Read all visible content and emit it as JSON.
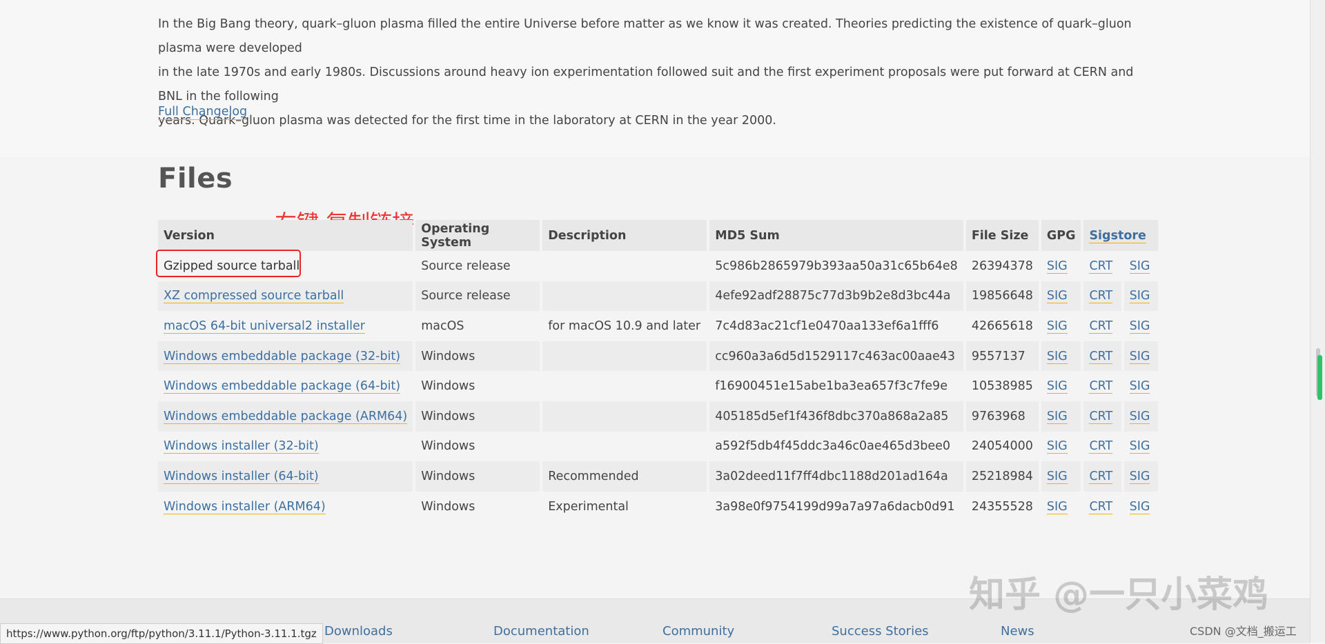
{
  "intro": {
    "line1": "In the Big Bang theory, quark–gluon plasma filled the entire Universe before matter as we know it was created. Theories predicting the existence of quark–gluon plasma were developed",
    "line2": "in the late 1970s and early 1980s. Discussions around heavy ion experimentation followed suit and the first experiment proposals were put forward at CERN and BNL in the following",
    "line3": "years. Quark–gluon plasma was detected for the first time in the laboratory at CERN in the year 2000."
  },
  "changelog_label": "Full Changelog",
  "files": {
    "title": "Files",
    "annotation": "右键 复制链接",
    "headers": {
      "version": "Version",
      "os": "Operating System",
      "description": "Description",
      "md5": "MD5 Sum",
      "size": "File Size",
      "gpg": "GPG",
      "sigstore": "Sigstore"
    },
    "sig_label": "SIG",
    "crt_label": "CRT",
    "rows": [
      {
        "version": "Gzipped source tarball",
        "os": "Source release",
        "description": "",
        "md5": "5c986b2865979b393aa50a31c65b64e8",
        "size": "26394378"
      },
      {
        "version": "XZ compressed source tarball",
        "os": "Source release",
        "description": "",
        "md5": "4efe92adf28875c77d3b9b2e8d3bc44a",
        "size": "19856648"
      },
      {
        "version": "macOS 64-bit universal2 installer",
        "os": "macOS",
        "description": "for macOS 10.9 and later",
        "md5": "7c4d83ac21cf1e0470aa133ef6a1fff6",
        "size": "42665618"
      },
      {
        "version": "Windows embeddable package (32-bit)",
        "os": "Windows",
        "description": "",
        "md5": "cc960a3a6d5d1529117c463ac00aae43",
        "size": "9557137"
      },
      {
        "version": "Windows embeddable package (64-bit)",
        "os": "Windows",
        "description": "",
        "md5": "f16900451e15abe1ba3ea657f3c7fe9e",
        "size": "10538985"
      },
      {
        "version": "Windows embeddable package (ARM64)",
        "os": "Windows",
        "description": "",
        "md5": "405185d5ef1f436f8dbc370a868a2a85",
        "size": "9763968"
      },
      {
        "version": "Windows installer (32-bit)",
        "os": "Windows",
        "description": "",
        "md5": "a592f5db4f45ddc3a46c0ae465d3bee0",
        "size": "24054000"
      },
      {
        "version": "Windows installer (64-bit)",
        "os": "Windows",
        "description": "Recommended",
        "md5": "3a02deed11f7ff4dbc1188d201ad164a",
        "size": "25218984"
      },
      {
        "version": "Windows installer (ARM64)",
        "os": "Windows",
        "description": "Experimental",
        "md5": "3a98e0f9754199d99a7a97a6dacb0d91",
        "size": "24355528"
      }
    ]
  },
  "status_url": "https://www.python.org/ftp/python/3.11.1/Python-3.11.1.tgz",
  "footer": {
    "downloads": "Downloads",
    "documentation": "Documentation",
    "community": "Community",
    "success_stories": "Success Stories",
    "news": "News"
  },
  "watermark": "知乎 @一只小菜鸡",
  "credit": "CSDN @文档_搬运工"
}
